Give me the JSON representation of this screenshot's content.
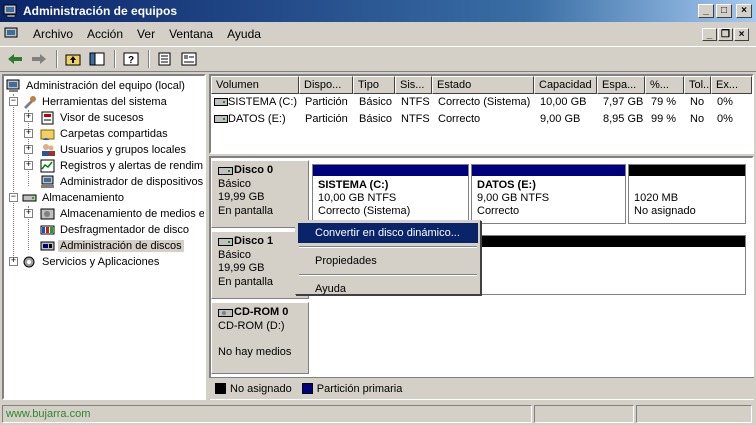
{
  "window": {
    "title": "Administración de equipos"
  },
  "menu": [
    "Archivo",
    "Acción",
    "Ver",
    "Ventana",
    "Ayuda"
  ],
  "toolbar_icons": [
    "back-icon",
    "forward-icon",
    "up-folder-icon",
    "show-hide-tree-icon",
    "help-icon",
    "export-list-icon",
    "properties-icon"
  ],
  "tree": {
    "root": "Administración del equipo (local)",
    "tools": "Herramientas del sistema",
    "event_viewer": "Visor de sucesos",
    "shared_folders": "Carpetas compartidas",
    "local_users": "Usuarios y grupos locales",
    "logs_alerts": "Registros y alertas de rendim",
    "device_manager": "Administrador de dispositivos",
    "storage": "Almacenamiento",
    "removable_storage": "Almacenamiento de medios ex",
    "defrag": "Desfragmentador de disco",
    "disk_mgmt": "Administración de discos",
    "services": "Servicios y Aplicaciones"
  },
  "volumes": {
    "headers": [
      "Volumen",
      "Dispo...",
      "Tipo",
      "Sis...",
      "Estado",
      "Capacidad",
      "Espa...",
      "%...",
      "Tol...",
      "Ex..."
    ],
    "rows": [
      [
        "SISTEMA (C:)",
        "Partición",
        "Básico",
        "NTFS",
        "Correcto (Sistema)",
        "10,00 GB",
        "7,97 GB",
        "79 %",
        "No",
        "0%"
      ],
      [
        "DATOS (E:)",
        "Partición",
        "Básico",
        "NTFS",
        "Correcto",
        "9,00 GB",
        "8,95 GB",
        "99 %",
        "No",
        "0%"
      ]
    ]
  },
  "disks": {
    "disk0": {
      "name": "Disco 0",
      "type": "Básico",
      "size": "19,99 GB",
      "state": "En pantalla"
    },
    "disk1": {
      "name": "Disco 1",
      "type": "Básico",
      "size": "19,99 GB",
      "state": "En pantalla"
    },
    "cdrom": {
      "name": "CD-ROM 0",
      "drive": "CD-ROM (D:)",
      "state": "No hay medios"
    }
  },
  "partitions": {
    "p1": {
      "name": "SISTEMA  (C:)",
      "size": "10,00 GB NTFS",
      "status": "Correcto (Sistema)"
    },
    "p2": {
      "name": "DATOS  (E:)",
      "size": "9,00 GB NTFS",
      "status": "Correcto"
    },
    "p3": {
      "size": "1020 MB",
      "status": "No asignado"
    }
  },
  "legend": {
    "unallocated": "No asignado",
    "primary": "Partición primaria"
  },
  "colors": {
    "primary": "#00007f",
    "unallocated": "#000000",
    "highlight": "#0a246a"
  },
  "context_menu": {
    "convert": "Convertir en disco dinámico...",
    "properties": "Propiedades",
    "help": "Ayuda"
  },
  "status": {
    "watermark": "www.bujarra.com"
  }
}
